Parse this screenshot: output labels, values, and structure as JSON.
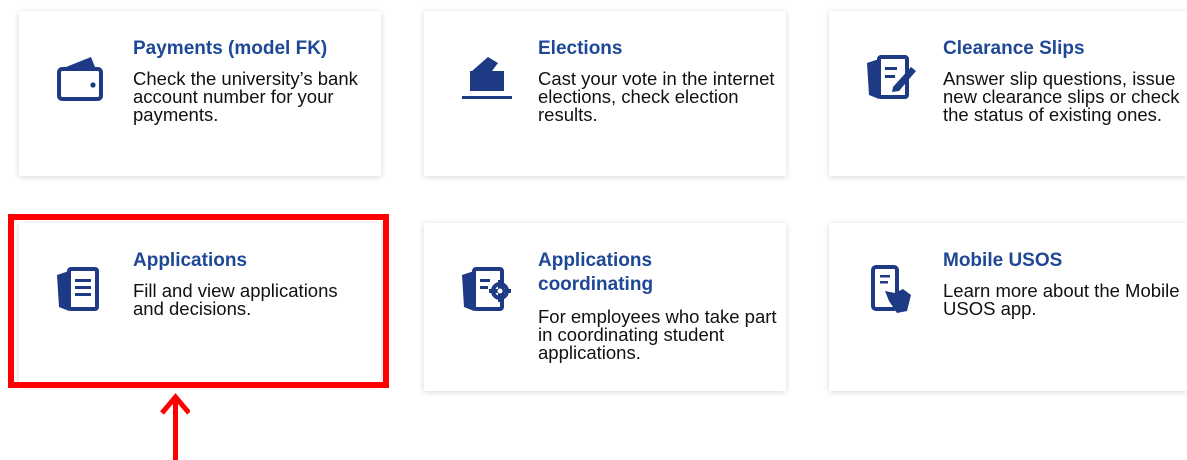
{
  "colors": {
    "title": "#1e4896",
    "icon": "#1e3a85",
    "highlight": "#ff0000",
    "text": "#111111"
  },
  "cards": [
    {
      "title": "Payments (model FK)",
      "description": "Check the university’s bank account number for your payments.",
      "icon": "wallet-icon"
    },
    {
      "title": "Elections",
      "description": "Cast your vote in the internet elections, check election results.",
      "icon": "ballot-box-icon"
    },
    {
      "title": "Clearance Slips",
      "description": "Answer slip questions, issue new clearance slips or check the status of existing ones.",
      "icon": "clearance-slip-icon"
    },
    {
      "title": "Applications",
      "description": "Fill and view applications and decisions.",
      "icon": "application-document-icon",
      "highlighted": true
    },
    {
      "title": "Applications coordinating",
      "description": "For employees who take part in coordinating student applications.",
      "icon": "application-settings-icon"
    },
    {
      "title": "Mobile USOS",
      "description": "Learn more about the Mobile USOS app.",
      "icon": "mobile-phone-icon"
    }
  ],
  "annotation": {
    "type": "arrow-pointing-up",
    "target": "Applications"
  }
}
